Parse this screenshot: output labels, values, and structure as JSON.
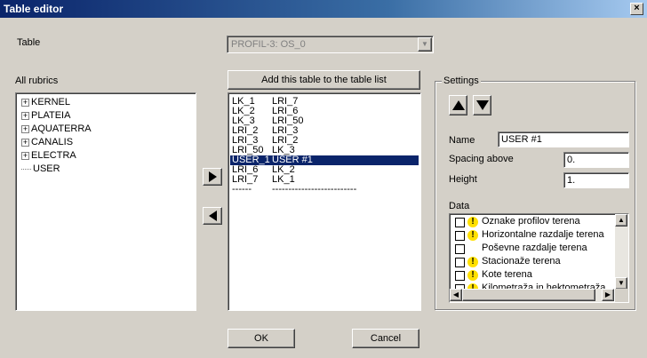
{
  "window": {
    "title": "Table editor",
    "close_glyph": "×"
  },
  "table": {
    "label": "Table",
    "value": "PROFIL-3: OS_0"
  },
  "rubrics": {
    "label": "All rubrics",
    "items": [
      {
        "label": "KERNEL",
        "expandable": true
      },
      {
        "label": "PLATEIA",
        "expandable": true
      },
      {
        "label": "AQUATERRA",
        "expandable": true
      },
      {
        "label": "CANALIS",
        "expandable": true
      },
      {
        "label": "ELECTRA",
        "expandable": true
      },
      {
        "label": "USER",
        "expandable": false
      }
    ]
  },
  "add_button": "Add this table to the table list",
  "table_list": [
    {
      "c1": "LK_1",
      "c2": "LRI_7"
    },
    {
      "c1": "LK_2",
      "c2": "LRI_6"
    },
    {
      "c1": "LK_3",
      "c2": "LRI_50"
    },
    {
      "c1": "LRI_2",
      "c2": "LRI_3"
    },
    {
      "c1": "LRI_3",
      "c2": "LRI_2"
    },
    {
      "c1": "LRI_50",
      "c2": "LK_3"
    },
    {
      "c1": "USER_1",
      "c2": "USER #1",
      "selected": true
    },
    {
      "c1": "LRI_6",
      "c2": "LK_2"
    },
    {
      "c1": "LRI_7",
      "c2": "LK_1"
    },
    {
      "c1": "------",
      "c2": "--------------------------"
    }
  ],
  "settings": {
    "legend": "Settings",
    "name_label": "Name",
    "name_value": "USER #1",
    "spacing_label": "Spacing above",
    "spacing_value": "0.",
    "height_label": "Height",
    "height_value": "1.",
    "data_label": "Data",
    "data_items": [
      {
        "label": "Oznake profilov terena",
        "warn": true
      },
      {
        "label": "Horizontalne razdalje terena",
        "warn": true
      },
      {
        "label": "Poševne razdalje terena",
        "warn": false
      },
      {
        "label": "Stacionaže terena",
        "warn": true
      },
      {
        "label": "Kote terena",
        "warn": true
      },
      {
        "label": "Kilometraža in hektometraža",
        "warn": true
      }
    ]
  },
  "ok_button": "OK",
  "cancel_button": "Cancel",
  "icons": {
    "up": "up-arrow-icon",
    "down": "down-arrow-icon",
    "right": "right-arrow-icon",
    "left": "left-arrow-icon",
    "warn": "warning-icon"
  }
}
